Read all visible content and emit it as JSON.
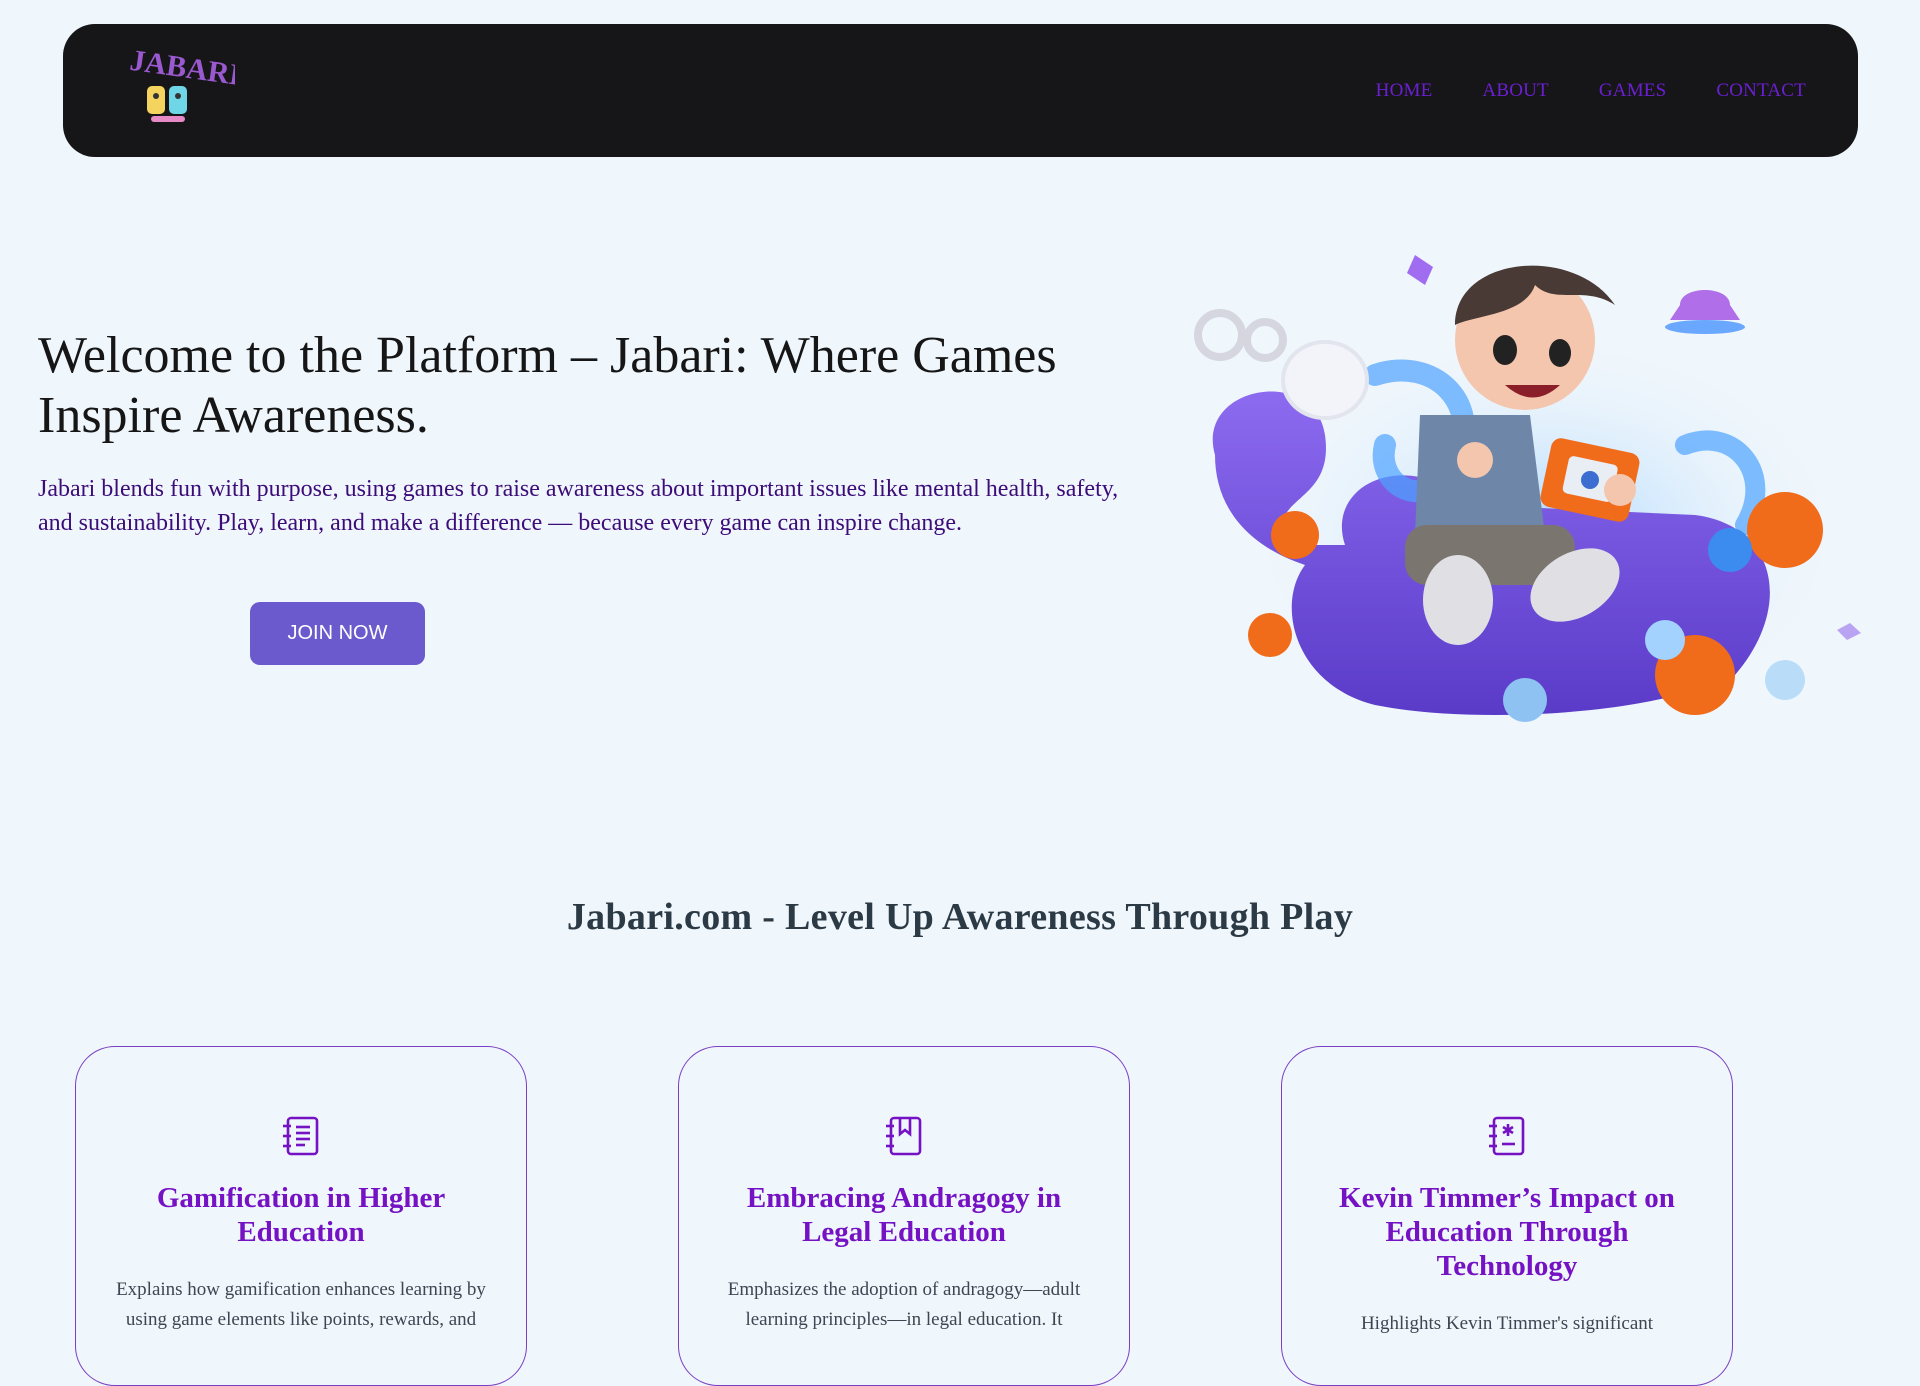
{
  "nav": {
    "logo_alt": "Jabari",
    "items": [
      {
        "label": "HOME"
      },
      {
        "label": "ABOUT"
      },
      {
        "label": "GAMES"
      },
      {
        "label": "CONTACT"
      }
    ]
  },
  "hero": {
    "title": "Welcome to the Platform – Jabari: Where Games Inspire Awareness.",
    "text": "Jabari blends fun with purpose, using games to raise awareness about important issues like mental health, safety, and sustainability. Play, learn, and make a difference — because every game can inspire change.",
    "cta_label": "JOIN NOW"
  },
  "section": {
    "title": "Jabari.com - Level Up Awareness Through Play"
  },
  "cards": [
    {
      "icon": "journal-text-icon",
      "title": "Gamification in Higher Education",
      "text": "Explains how gamification enhances learning by using game elements like points, rewards, and"
    },
    {
      "icon": "journal-bookmark-icon",
      "title": "Embracing Andragogy in Legal Education",
      "text": "Emphasizes the adoption of andragogy—adult learning principles—in legal education. It"
    },
    {
      "icon": "journal-medical-icon",
      "title": "Kevin Timmer’s Impact on Education Through Technology",
      "text": "Highlights Kevin Timmer's significant"
    }
  ],
  "colors": {
    "background": "#eff6fc",
    "navbar": "#161618",
    "nav_link": "#6b1fd1",
    "button": "#6a5acd",
    "card_title": "#7512c4",
    "card_border": "#7b3fc4"
  }
}
